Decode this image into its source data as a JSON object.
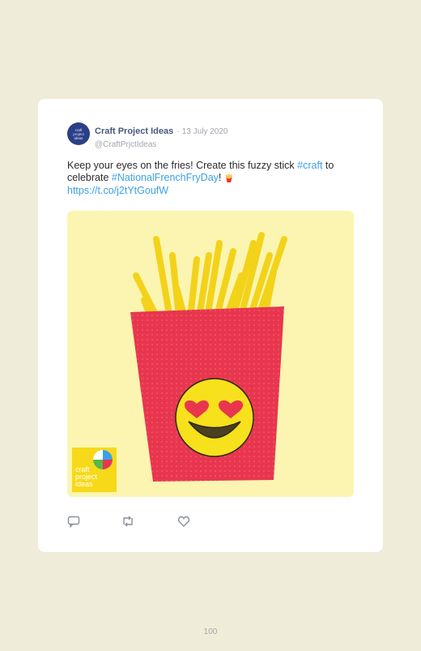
{
  "tweet": {
    "author_name": "Craft Project Ideas",
    "date": "· 13 July 2020",
    "handle": "@CraftPrjctIdeas",
    "avatar_text": [
      "craft",
      "project",
      "ideas"
    ],
    "text_part1": "Keep your eyes on the fries! Create this fuzzy stick ",
    "hashtag1": "#craft",
    "text_part2": " to celebrate ",
    "hashtag2": "#NationalFrenchFryDay",
    "text_part3": "! ",
    "emoji": "🍟",
    "link": "https://t.co/j2tYtGoufW"
  },
  "media": {
    "watermark_lines": [
      "craft",
      "project",
      "ideas"
    ]
  },
  "actions": {
    "reply_icon": "reply-icon",
    "retweet_icon": "retweet-icon",
    "like_icon": "heart-icon"
  },
  "footer": {
    "page_number": "100"
  },
  "colors": {
    "page_bg": "#efecd9",
    "link": "#3aa1e4",
    "author": "#465a7d",
    "fries_container": "#e8364e",
    "fries": "#f3d21a"
  }
}
